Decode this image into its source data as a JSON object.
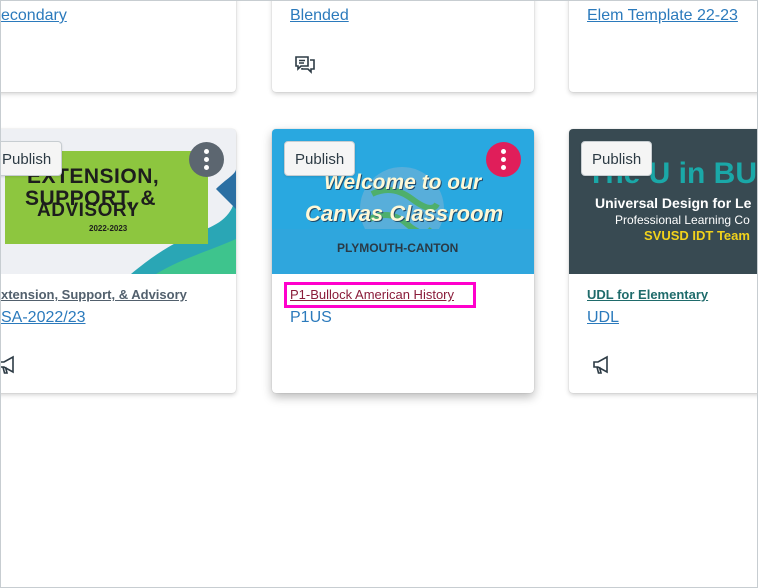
{
  "top_row": {
    "card1": {
      "subtitle": "econdary"
    },
    "card2": {
      "subtitle": "Blended",
      "icon": "discussion-icon"
    },
    "card3": {
      "subtitle": "Elem Template 22-23"
    }
  },
  "cards": [
    {
      "publish_label": "Publish",
      "hero_lines": [
        "EXTENSION,",
        "SUPPORT, &",
        "ADVISORY"
      ],
      "hero_year": "2022-2023",
      "course_name": "xtension, Support, & Advisory",
      "course_code": "SA-2022/23",
      "kebab_color": "#5c6670",
      "icon": "announcement-icon"
    },
    {
      "publish_label": "Publish",
      "hero_line1": "Welcome to our",
      "hero_line2": "Canvas Classroom",
      "hero_district": "PLYMOUTH-CANTON",
      "course_name": "P1-Bullock American History",
      "course_code": "P1US",
      "kebab_color": "#e01e5a"
    },
    {
      "publish_label": "Publish",
      "hero_big": "The U in BU",
      "hero_line1": "Universal Design for Le",
      "hero_line2": "Professional Learning Co",
      "hero_line3": "SVUSD IDT Team",
      "course_name": "UDL for Elementary",
      "course_code": "UDL",
      "icon": "announcement-icon"
    }
  ],
  "colors": {
    "link": "#2b7abc",
    "highlight": "#ff00cc",
    "hero2_bg": "#29a8e0",
    "hero3_bg": "#384a52"
  }
}
